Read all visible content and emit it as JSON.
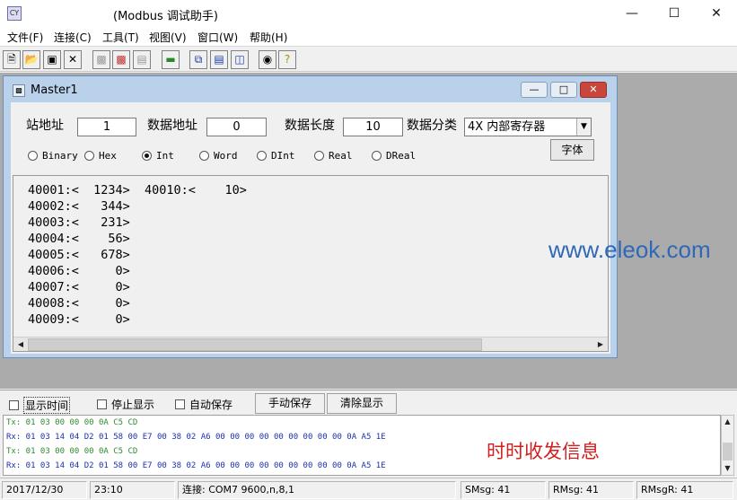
{
  "app": {
    "title": "(Modbus 调试助手)",
    "icon_text": "CY"
  },
  "menu": [
    "文件(F)",
    "连接(C)",
    "工具(T)",
    "视图(V)",
    "窗口(W)",
    "帮助(H)"
  ],
  "toolbar": {
    "icons": [
      "new-file",
      "open-folder",
      "save-disk",
      "close-x",
      "device",
      "device-disconnect",
      "device-copy",
      "connect",
      "window-cascade",
      "window-tile-h",
      "window-tile-v",
      "binoculars",
      "help-question"
    ]
  },
  "master": {
    "title": "Master1",
    "station_label": "站地址",
    "station_value": "1",
    "address_label": "数据地址",
    "address_value": "0",
    "length_label": "数据长度",
    "length_value": "10",
    "category_label": "数据分类",
    "category_value": "4X 内部寄存器",
    "font_button": "字体",
    "formats": [
      "Binary",
      "Hex",
      "Int",
      "Word",
      "DInt",
      "Real",
      "DReal"
    ],
    "selected_format": "Int",
    "register_lines": [
      "40001:<  1234>  40010:<    10>",
      "40002:<   344>",
      "40003:<   231>",
      "40004:<    56>",
      "40005:<   678>",
      "40006:<     0>",
      "40007:<     0>",
      "40008:<     0>",
      "40009:<     0>"
    ],
    "watermark": "www.eleok.com"
  },
  "panel": {
    "show_time": "显示时间",
    "stop_display": "停止显示",
    "auto_save": "自动保存",
    "manual_save": "手动保存",
    "clear_display": "清除显示"
  },
  "log": {
    "lines": [
      {
        "dir": "tx",
        "text": "Tx: 01 03 00 00 00 0A C5 CD"
      },
      {
        "dir": "rx",
        "text": "Rx: 01 03 14 04 D2 01 58 00 E7 00 38 02 A6 00 00 00 00 00 00 00 00 00 0A A5 1E"
      },
      {
        "dir": "tx",
        "text": "Tx: 01 03 00 00 00 0A C5 CD"
      },
      {
        "dir": "rx",
        "text": "Rx: 01 03 14 04 D2 01 58 00 E7 00 38 02 A6 00 00 00 00 00 00 00 00 00 0A A5 1E"
      }
    ],
    "note": "时时收发信息"
  },
  "status": {
    "date": "2017/12/30",
    "time": "23:10",
    "connection": "连接: COM7  9600,n,8,1",
    "smsg": "SMsg: 41",
    "rmsg": "RMsg: 41",
    "rmsgr": "RMsgR: 41"
  }
}
